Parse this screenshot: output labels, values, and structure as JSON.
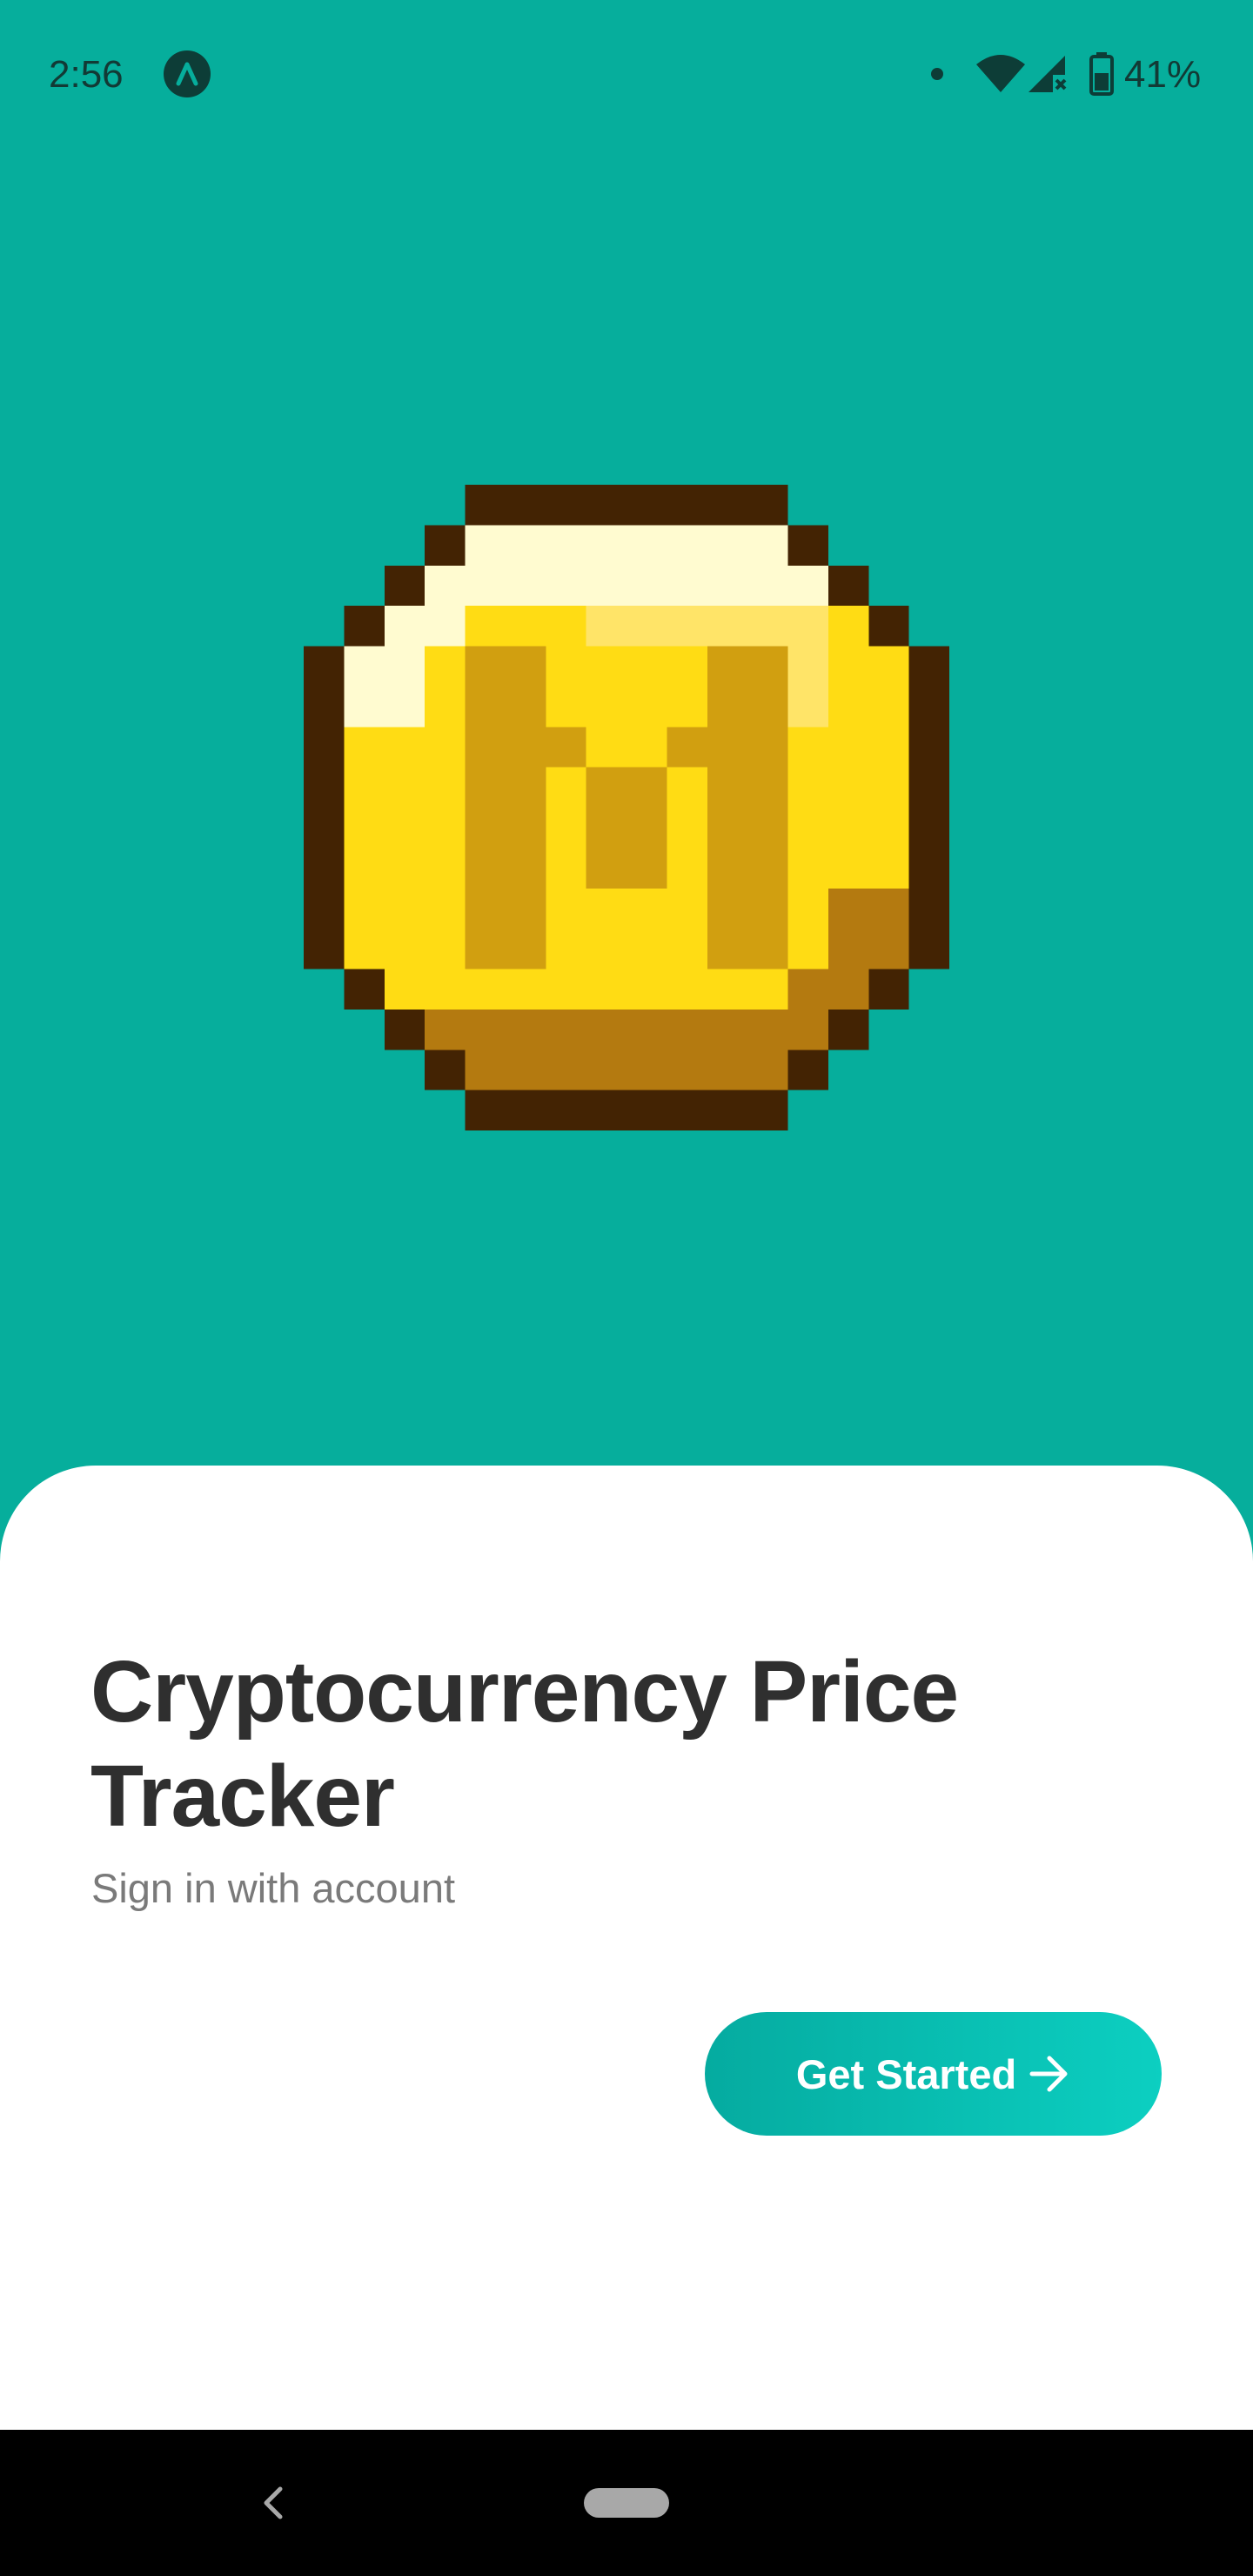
{
  "status_bar": {
    "time": "2:56",
    "battery": "41%",
    "icons": [
      "app-notification-icon",
      "dot-icon",
      "wifi-icon",
      "signal-icon",
      "battery-icon"
    ]
  },
  "hero": {
    "coin_icon": "pixel-coin-icon"
  },
  "sheet": {
    "title": "Cryptocurrency Price Tracker",
    "subtitle": "Sign in with account",
    "button_label": "Get Started",
    "button_icon": "arrow-right-icon"
  },
  "nav_bar": {
    "icons": [
      "back-icon",
      "home-pill-icon"
    ]
  },
  "colors": {
    "background": "#06AE9C",
    "sheet": "#FFFFFF",
    "title": "#2F2F2F",
    "subtitle": "#7A7A7A",
    "button_start": "#05ABA0",
    "button_end": "#0CCFC1",
    "coin_outline": "#432303",
    "coin_gold": "#FFDC14",
    "coin_shade": "#D19F10",
    "coin_dark": "#B47A10",
    "coin_highlight": "#FFFBD0"
  }
}
